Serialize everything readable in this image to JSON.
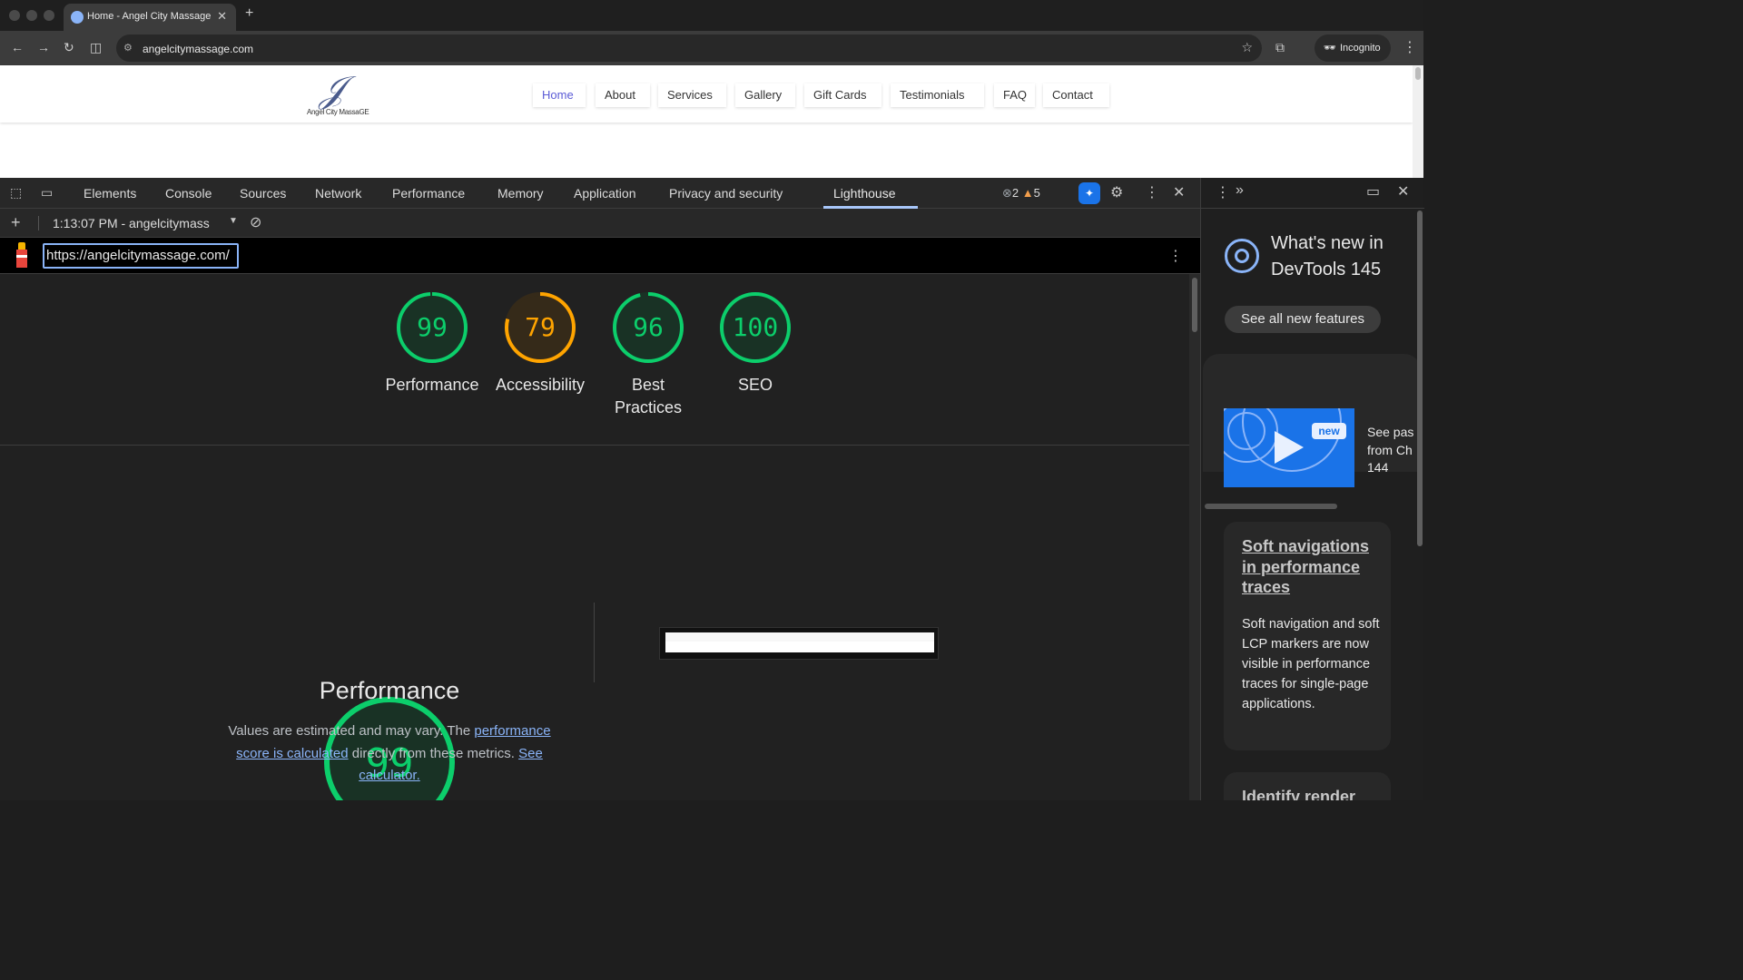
{
  "browser": {
    "tab_title": "Home - Angel City Massage",
    "url": "angelcitymassage.com",
    "incognito_label": "Incognito"
  },
  "site": {
    "logo_text": "Angel City MassaGE",
    "nav": [
      "Home",
      "About",
      "Services",
      "Gallery",
      "Gift Cards",
      "Testimonials",
      "FAQ",
      "Contact"
    ]
  },
  "devtools": {
    "tabs": [
      "Elements",
      "Console",
      "Sources",
      "Network",
      "Performance",
      "Memory",
      "Application",
      "Privacy and security",
      "Lighthouse"
    ],
    "error_count": "2",
    "warning_count": "5",
    "report_selector": "1:13:07 PM - angelcitymass",
    "report_url": "https://angelcitymassage.com/"
  },
  "lighthouse": {
    "scores": [
      {
        "value": 99,
        "label": "Performance",
        "color": "#0cce6b",
        "fill": "#193225"
      },
      {
        "value": 79,
        "label": "Accessibility",
        "color": "#ffa400",
        "fill": "#352a19"
      },
      {
        "value": 96,
        "label": "Best Practices",
        "color": "#0cce6b",
        "fill": "#193225"
      },
      {
        "value": 100,
        "label": "SEO",
        "color": "#0cce6b",
        "fill": "#193225"
      }
    ],
    "big_score": {
      "value": "99",
      "title": "Performance"
    },
    "desc_part1": "Values are estimated and may vary. The ",
    "desc_link1": "performance score is calculated",
    "desc_part2": " directly from these metrics. ",
    "desc_link2": "See calculator."
  },
  "drawer": {
    "title": "What's new in DevTools 145",
    "see_all": "See all new features",
    "video_badge": "new",
    "video_text_lines": [
      "See pas",
      "from Ch",
      "144"
    ],
    "feature1_title": "Soft navigations in performance traces",
    "feature1_body": "Soft navigation and soft LCP markers are now visible in performance traces for single-page applications.",
    "feature2_title": "Identify render blocking"
  }
}
